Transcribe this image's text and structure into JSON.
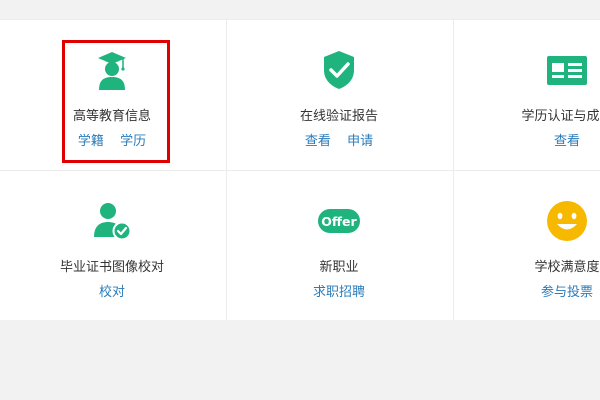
{
  "colors": {
    "accent": "#1fb37e",
    "link": "#2a7cba",
    "smiley": "#f6b900",
    "highlight": "#e00000"
  },
  "row1": [
    {
      "title": "高等教育信息",
      "icon": "graduate-icon",
      "links": [
        "学籍",
        "学历"
      ]
    },
    {
      "title": "在线验证报告",
      "icon": "shield-check-icon",
      "links": [
        "查看",
        "申请"
      ]
    },
    {
      "title": "学历认证与成绩",
      "icon": "id-card-icon",
      "links": [
        "查看"
      ]
    }
  ],
  "row2": [
    {
      "title": "毕业证书图像校对",
      "icon": "user-check-icon",
      "links": [
        "校对"
      ]
    },
    {
      "title": "新职业",
      "icon": "offer-badge-icon",
      "badge_text": "Offer",
      "links": [
        "求职招聘"
      ]
    },
    {
      "title": "学校满意度",
      "icon": "smiley-icon",
      "links": [
        "参与投票"
      ]
    }
  ]
}
